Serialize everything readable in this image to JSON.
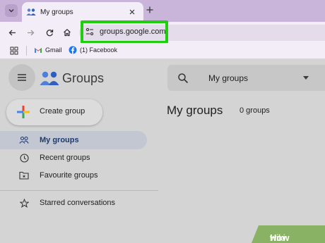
{
  "browser": {
    "tab_title": "My groups",
    "url": "groups.google.com",
    "bookmarks": [
      {
        "label": "Gmail",
        "icon": "gmail-icon"
      },
      {
        "label": "(1) Facebook",
        "icon": "facebook-icon"
      }
    ],
    "highlight_color": "#22cc11"
  },
  "app": {
    "name": "Groups",
    "create_button": "Create group",
    "nav": [
      {
        "label": "My groups",
        "icon": "groups-icon",
        "active": true
      },
      {
        "label": "Recent groups",
        "icon": "clock-icon"
      },
      {
        "label": "Favourite groups",
        "icon": "folder-star-icon"
      },
      {
        "label": "Starred conversations",
        "icon": "star-icon"
      }
    ],
    "search_scope": "My groups",
    "heading": "My groups",
    "group_count": "0 groups"
  },
  "watermark": {
    "part1": "wiki",
    "part2": "How"
  }
}
